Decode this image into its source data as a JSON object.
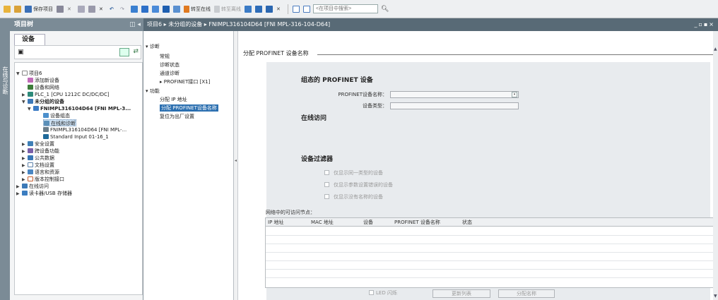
{
  "toolbar": {
    "save_label": "保存项目",
    "online_label": "转至在线",
    "offline_label": "转至离线",
    "search_placeholder": "<在项目中搜索>"
  },
  "left": {
    "title": "项目树",
    "device_tab": "设备",
    "strip_label": "在线与诊断",
    "tree": [
      {
        "label": "项目6"
      },
      {
        "label": "添加新设备"
      },
      {
        "label": "设备和网络"
      },
      {
        "label": "PLC_1 [CPU 1212C DC/DC/DC]"
      },
      {
        "label": "未分组的设备"
      },
      {
        "label": "FNIMPL316104D64 [FNI MPL-3..."
      },
      {
        "label": "设备组态"
      },
      {
        "label": "在线和诊断"
      },
      {
        "label": "FNIMPL316104D64 [FNI MPL-..."
      },
      {
        "label": "Standard Input 01-16_1"
      },
      {
        "label": "安全设置"
      },
      {
        "label": "跨设备功能"
      },
      {
        "label": "公共数据"
      },
      {
        "label": "文档设置"
      },
      {
        "label": "语言和资源"
      },
      {
        "label": "版本控制接口"
      },
      {
        "label": "在线访问"
      },
      {
        "label": "读卡器/USB 存储器"
      }
    ]
  },
  "header": {
    "breadcrumb": "项目6 ▸ 未分组的设备 ▸ FNIMPL316104D64 [FNI MPL-316-104-D64]"
  },
  "nav": {
    "items": [
      {
        "label": "▾ 诊断"
      },
      {
        "label": "常规"
      },
      {
        "label": "诊断状态"
      },
      {
        "label": "通道诊断"
      },
      {
        "label": "▸ PROFINET接口 [X1]"
      },
      {
        "label": "▾ 功能"
      },
      {
        "label": "分配 IP 地址"
      },
      {
        "label": "分配 PROFINET设备名称"
      },
      {
        "label": "复位为出厂设置"
      }
    ]
  },
  "content": {
    "section_title": "分配 PROFINET 设备名称",
    "configured_heading": "组态的 PROFINET 设备",
    "device_name_label": "PROFINET设备名称：",
    "device_type_label": "设备类型：",
    "online_access_heading": "在线访问",
    "filter_heading": "设备过滤器",
    "filter_options": [
      {
        "label": "仅显示同一类型的设备"
      },
      {
        "label": "仅显示参数设置错误的设备"
      },
      {
        "label": "仅显示没有名称的设备"
      }
    ],
    "table_title": "网络中的可访问节点：",
    "table_columns": [
      "IP 地址",
      "MAC 地址",
      "设备",
      "PROFINET 设备名称",
      "状态"
    ],
    "led_label": "LED 闪烁",
    "refresh_button": "更新列表",
    "assign_button": "分配名称"
  },
  "colors": {
    "nav_active": "#2b6fb0",
    "header_bg": "#586a76",
    "project_tree_header": "#7b8b96"
  }
}
